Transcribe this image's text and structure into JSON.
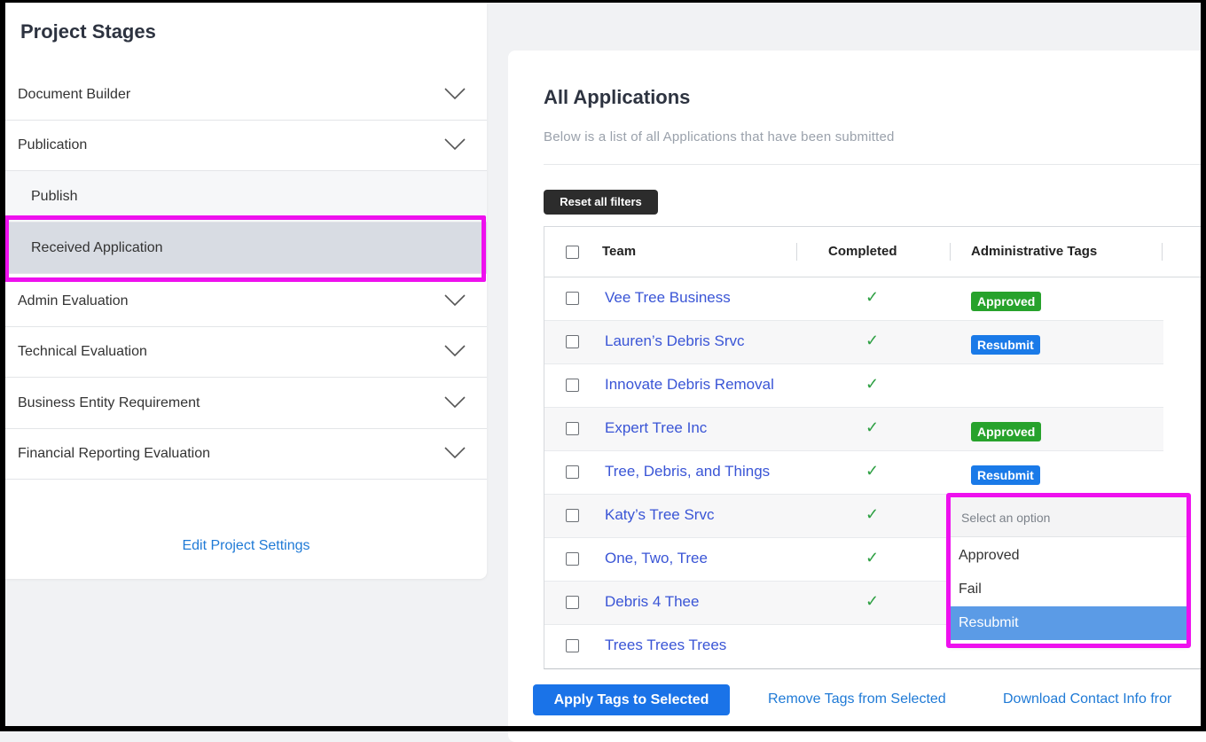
{
  "sidebar": {
    "title": "Project Stages",
    "items": [
      {
        "label": "Document Builder"
      },
      {
        "label": "Publication"
      },
      {
        "label": "Publish"
      },
      {
        "label": "Received Application"
      },
      {
        "label": "Admin Evaluation"
      },
      {
        "label": "Technical Evaluation"
      },
      {
        "label": "Business Entity Requirement"
      },
      {
        "label": "Financial Reporting Evaluation"
      }
    ],
    "edit_link": "Edit Project Settings"
  },
  "main": {
    "title": "All Applications",
    "subtitle": "Below is a list of all Applications that have been submitted",
    "reset_button": "Reset all filters",
    "columns": {
      "team": "Team",
      "completed": "Completed",
      "tags": "Administrative Tags"
    },
    "rows": [
      {
        "team": "Vee Tree Business",
        "completed": "✓",
        "tag": "Approved"
      },
      {
        "team": "Lauren’s Debris Srvc",
        "completed": "✓",
        "tag": "Resubmit"
      },
      {
        "team": "Innovate Debris Removal",
        "completed": "✓",
        "tag": ""
      },
      {
        "team": "Expert Tree Inc",
        "completed": "✓",
        "tag": "Approved"
      },
      {
        "team": "Tree, Debris, and Things",
        "completed": "✓",
        "tag": "Resubmit"
      },
      {
        "team": "Katy’s Tree Srvc",
        "completed": "✓",
        "tag": ""
      },
      {
        "team": "One, Two, Tree",
        "completed": "✓",
        "tag": ""
      },
      {
        "team": "Debris 4 Thee",
        "completed": "✓",
        "tag": ""
      },
      {
        "team": "Trees Trees Trees",
        "completed": "",
        "tag": ""
      }
    ],
    "dropdown": {
      "placeholder": "Select an option",
      "options": [
        "Approved",
        "Fail",
        "Resubmit"
      ],
      "selected": "Resubmit"
    },
    "actions": {
      "apply": "Apply Tags to Selected",
      "remove": "Remove Tags from Selected",
      "download": "Download Contact Info fror"
    }
  },
  "colors": {
    "approved": "#27a22c",
    "resubmit": "#1a7ae8",
    "highlight": "#ee10ee",
    "link": "#3a55d6"
  }
}
